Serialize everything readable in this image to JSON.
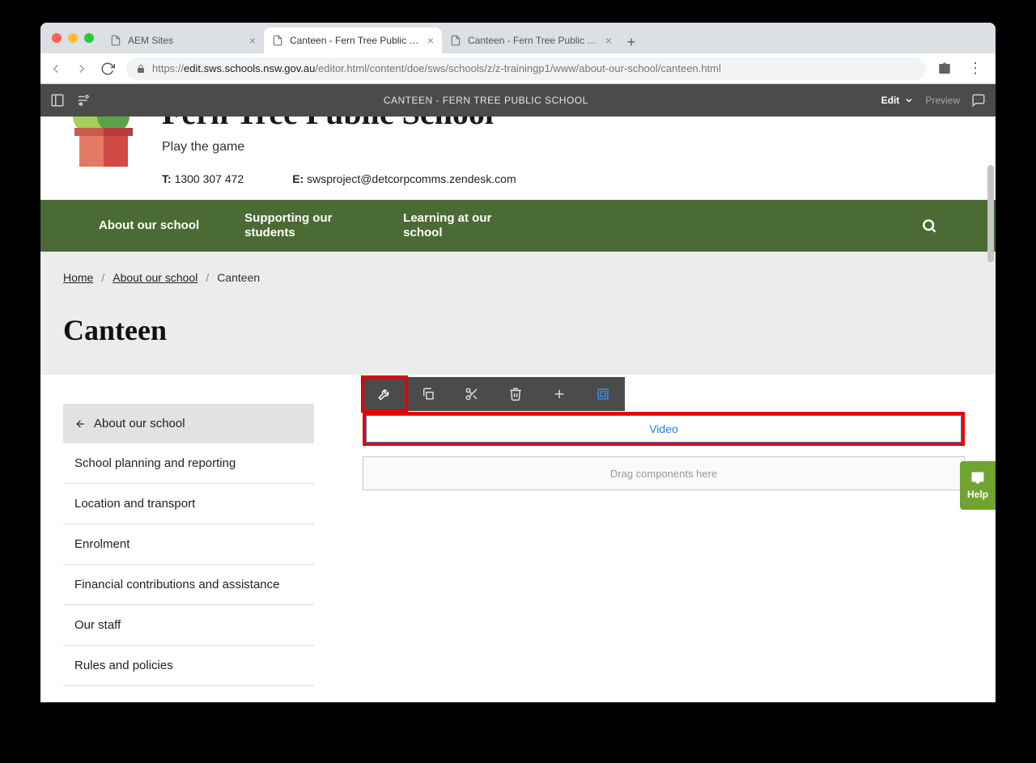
{
  "browser": {
    "tabs": [
      {
        "title": "AEM Sites",
        "active": false
      },
      {
        "title": "Canteen - Fern Tree Public Sch",
        "active": true
      },
      {
        "title": "Canteen - Fern Tree Public Sch",
        "active": false
      }
    ],
    "url_prefix": "https://",
    "url_domain": "edit.sws.schools.nsw.gov.au",
    "url_path": "/editor.html/content/doe/sws/schools/z/z-trainingp1/www/about-our-school/canteen.html"
  },
  "aem": {
    "title": "CANTEEN - FERN TREE PUBLIC SCHOOL",
    "mode": "Edit",
    "preview": "Preview"
  },
  "school": {
    "name": "Fern Tree Public School",
    "tagline": "Play the game",
    "phone_label": "T:",
    "phone": "1300 307 472",
    "email_label": "E:",
    "email": "swsproject@detcorpcomms.zendesk.com"
  },
  "nav": {
    "items": [
      "About our school",
      "Supporting our students",
      "Learning at our school"
    ]
  },
  "breadcrumb": {
    "home": "Home",
    "parent": "About our school",
    "current": "Canteen"
  },
  "page": {
    "title": "Canteen"
  },
  "sidebar": {
    "back_label": "About our school",
    "items": [
      "School planning and reporting",
      "Location and transport",
      "Enrolment",
      "Financial contributions and assistance",
      "Our staff",
      "Rules and policies"
    ]
  },
  "editor": {
    "selected_component": "Video",
    "drop_hint": "Drag components here"
  },
  "help": {
    "label": "Help"
  }
}
